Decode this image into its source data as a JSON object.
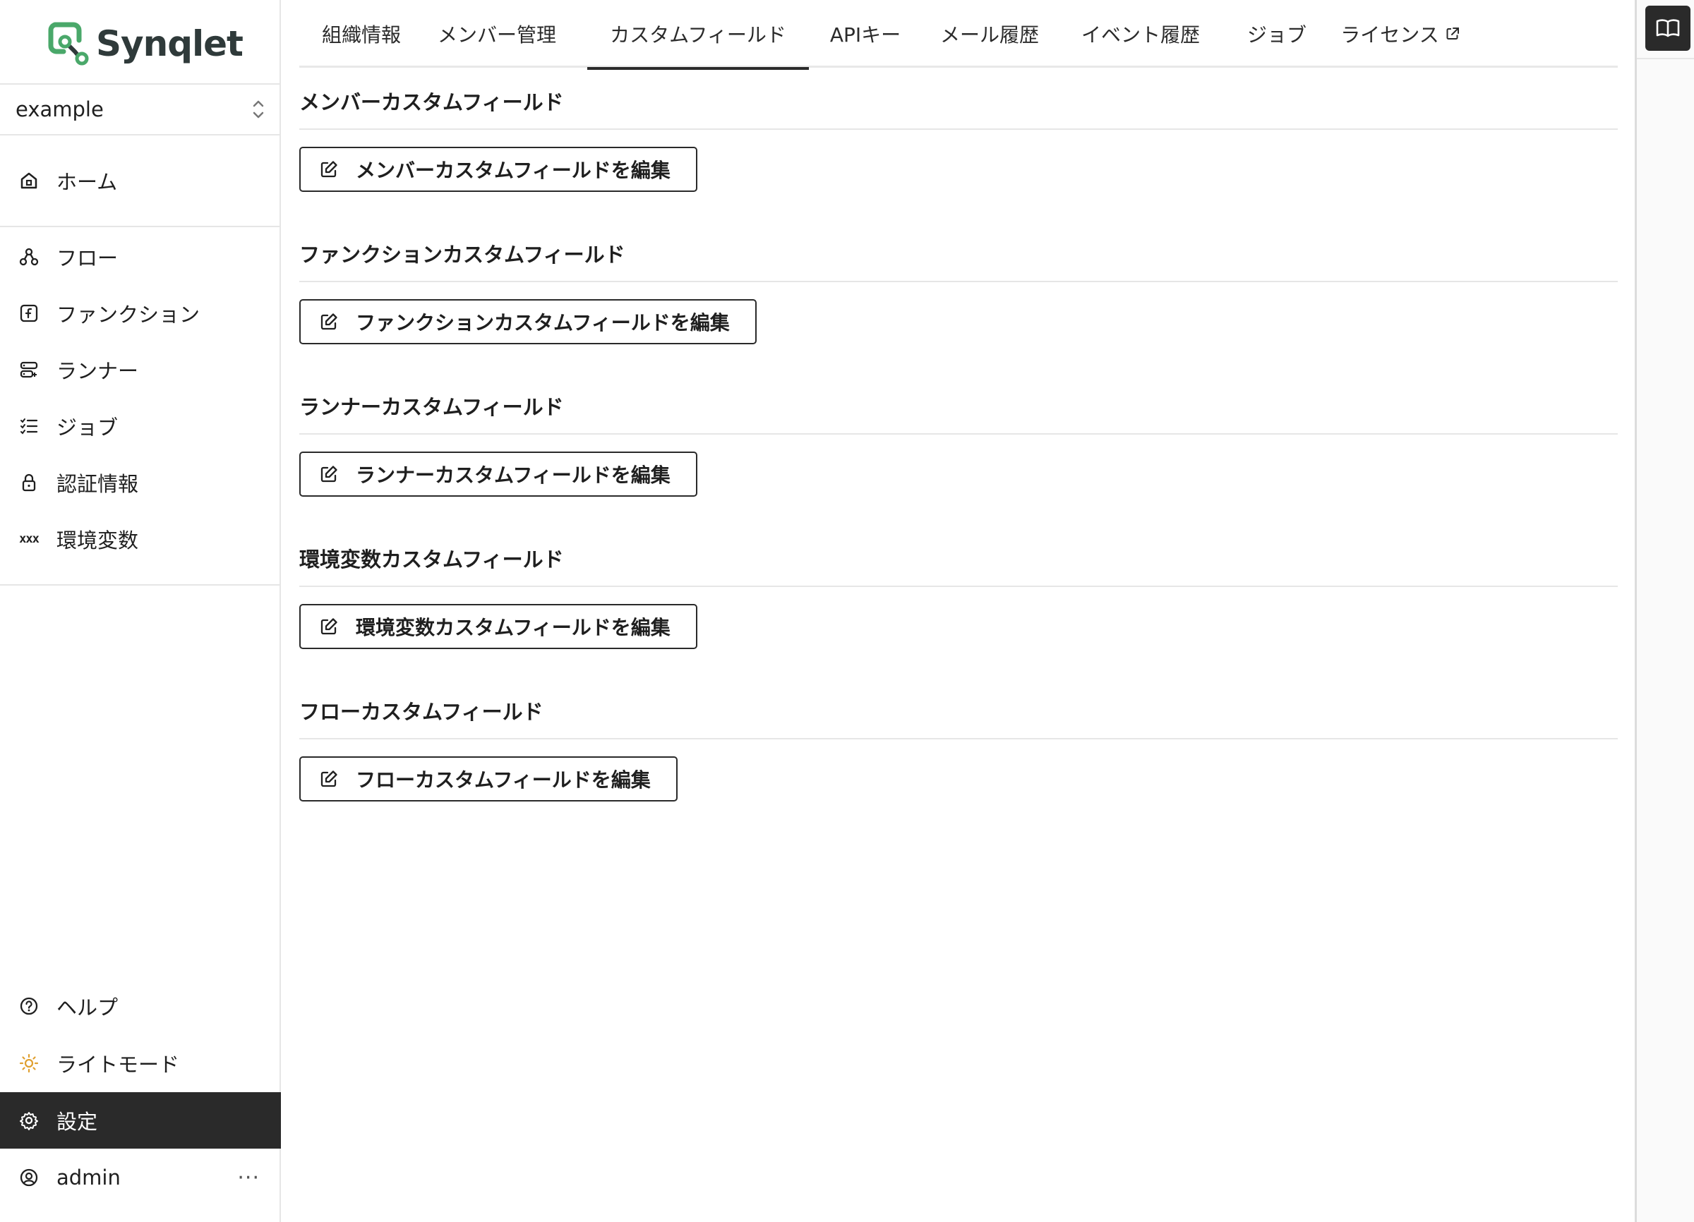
{
  "app": {
    "name": "Synqlet",
    "brand_color": "#4aa86a"
  },
  "org_select": {
    "value": "example"
  },
  "sidebar": {
    "home": "ホーム",
    "items": [
      {
        "label": "フロー",
        "icon": "flow-icon"
      },
      {
        "label": "ファンクション",
        "icon": "function-icon"
      },
      {
        "label": "ランナー",
        "icon": "runner-icon"
      },
      {
        "label": "ジョブ",
        "icon": "jobs-icon"
      },
      {
        "label": "認証情報",
        "icon": "lock-icon"
      },
      {
        "label": "環境変数",
        "icon": "variables-icon",
        "glyph": "xxx"
      }
    ],
    "bottom": [
      {
        "label": "ヘルプ",
        "icon": "help-icon"
      },
      {
        "label": "ライトモード",
        "icon": "sun-icon"
      },
      {
        "label": "設定",
        "icon": "gear-icon",
        "active": true
      },
      {
        "label": "admin",
        "icon": "user-icon"
      }
    ]
  },
  "tabs": [
    {
      "label": "組織情報"
    },
    {
      "label": "メンバー管理"
    },
    {
      "label": "カスタムフィールド",
      "active": true
    },
    {
      "label": "APIキー"
    },
    {
      "label": "メール履歴"
    },
    {
      "label": "イベント履歴"
    },
    {
      "label": "ジョブ"
    },
    {
      "label": "ライセンス",
      "external": true
    }
  ],
  "sections": [
    {
      "title": "メンバーカスタムフィールド",
      "button": "メンバーカスタムフィールドを編集"
    },
    {
      "title": "ファンクションカスタムフィールド",
      "button": "ファンクションカスタムフィールドを編集"
    },
    {
      "title": "ランナーカスタムフィールド",
      "button": "ランナーカスタムフィールドを編集"
    },
    {
      "title": "環境変数カスタムフィールド",
      "button": "環境変数カスタムフィールドを編集"
    },
    {
      "title": "フローカスタムフィールド",
      "button": "フローカスタムフィールドを編集"
    }
  ],
  "more_menu": "···"
}
